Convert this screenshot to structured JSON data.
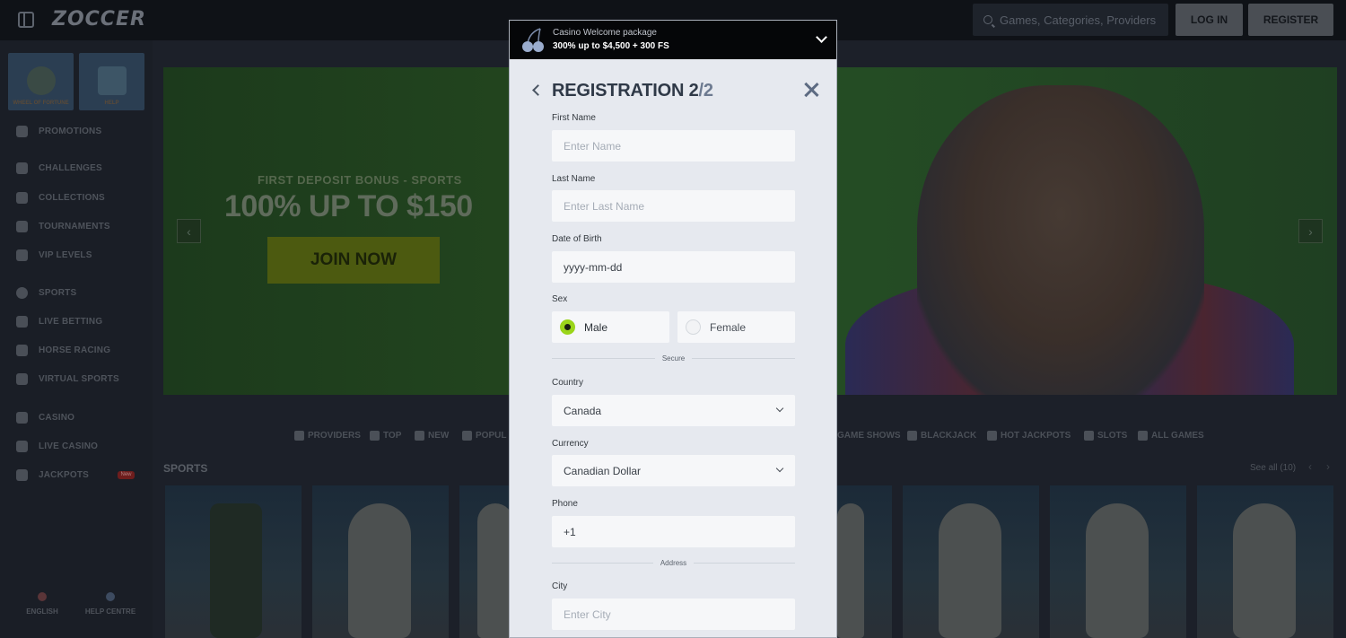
{
  "header": {
    "logo": "ZOCCER",
    "search_placeholder": "Games, Categories, Providers",
    "login_label": "LOG IN",
    "register_label": "REGISTER"
  },
  "sidebar": {
    "tiles": [
      {
        "label": "WHEEL OF FORTUNE"
      },
      {
        "label": "HELP"
      }
    ],
    "items": [
      {
        "label": "PROMOTIONS",
        "icon": "gift-icon"
      },
      {
        "label": "CHALLENGES",
        "icon": "trophy-icon"
      },
      {
        "label": "COLLECTIONS",
        "icon": "collection-icon"
      },
      {
        "label": "TOURNAMENTS",
        "icon": "tournament-icon"
      },
      {
        "label": "VIP LEVELS",
        "icon": "shield-icon"
      },
      {
        "label": "SPORTS",
        "icon": "ball-icon"
      },
      {
        "label": "LIVE BETTING",
        "icon": "live-icon"
      },
      {
        "label": "HORSE RACING",
        "icon": "horse-icon"
      },
      {
        "label": "VIRTUAL SPORTS",
        "icon": "virtual-icon"
      },
      {
        "label": "CASINO",
        "icon": "chips-icon"
      },
      {
        "label": "LIVE CASINO",
        "icon": "cards-icon"
      },
      {
        "label": "JACKPOTS",
        "icon": "horseshoe-icon"
      }
    ],
    "jackpots_badge": "New",
    "footer": {
      "language": "ENGLISH",
      "help": "HELP CENTRE"
    }
  },
  "hero": {
    "kicker": "FIRST DEPOSIT BONUS - SPORTS",
    "title": "100% UP TO $150",
    "cta": "JOIN NOW",
    "prev": "‹",
    "next": "›"
  },
  "categories": [
    {
      "label": "PROVIDERS"
    },
    {
      "label": "TOP"
    },
    {
      "label": "NEW"
    },
    {
      "label": "POPUL"
    },
    {
      "label": "GAME SHOWS"
    },
    {
      "label": "BLACKJACK"
    },
    {
      "label": "HOT JACKPOTS"
    },
    {
      "label": "SLOTS"
    },
    {
      "label": "ALL GAMES"
    }
  ],
  "sports_section": {
    "title": "SPORTS",
    "see_all": "See all (10)",
    "prev": "‹",
    "next": "›"
  },
  "modal": {
    "promo": {
      "line1": "Casino Welcome package",
      "line2": "300% up to $4,500 + 300 FS"
    },
    "title": "REGISTRATION 2",
    "title_step": "/2",
    "fields": {
      "first_name": {
        "label": "First Name",
        "placeholder": "Enter Name"
      },
      "last_name": {
        "label": "Last Name",
        "placeholder": "Enter Last Name"
      },
      "dob": {
        "label": "Date of Birth",
        "value": "yyyy-mm-dd"
      },
      "sex": {
        "label": "Sex",
        "options": [
          "Male",
          "Female"
        ],
        "selected": "Male"
      },
      "secure_divider": "Secure",
      "country": {
        "label": "Country",
        "value": "Canada"
      },
      "currency": {
        "label": "Currency",
        "value": "Canadian Dollar"
      },
      "phone": {
        "label": "Phone",
        "value": "+1"
      },
      "address_divider": "Address",
      "city": {
        "label": "City",
        "placeholder": "Enter City"
      }
    },
    "accent": "#9bd51a"
  }
}
